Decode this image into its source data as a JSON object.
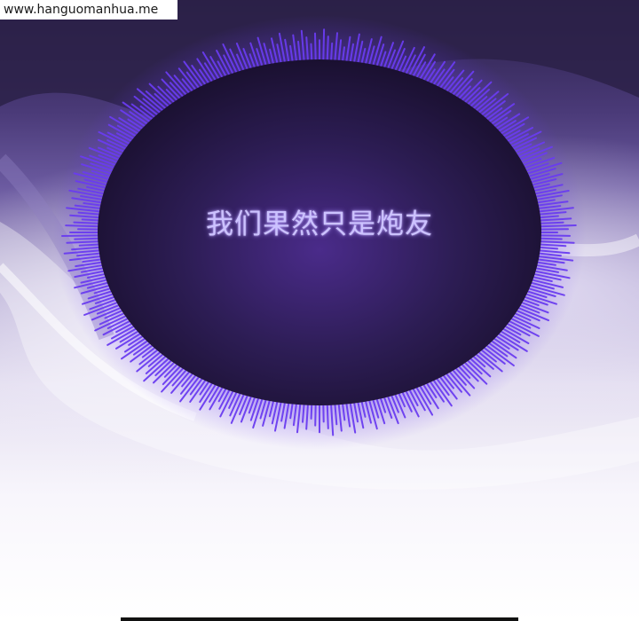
{
  "watermark": {
    "text": "www.hanguomanhua.me"
  },
  "panel": {
    "caption": "我们果然只是炮友",
    "colors": {
      "orb_fill_center": "#4a2b8a",
      "orb_fill_edge": "#1a1030",
      "orb_spikes": "#6a3cf0",
      "caption_text": "#ccc2ff",
      "sky_top": "#2a1f48",
      "sky_bottom": "#ffffff"
    },
    "icons": [
      "spiky-dark-orb"
    ]
  }
}
